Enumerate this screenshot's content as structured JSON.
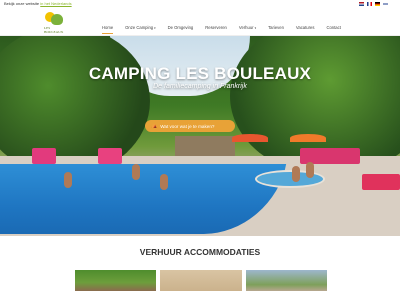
{
  "topbar": {
    "view_text": "Bekijk onze website",
    "view_link": "in het Nederlands"
  },
  "languages": [
    {
      "icon": "nl-flag-icon",
      "color": "#ae1c28"
    },
    {
      "icon": "fr-flag-icon",
      "color": "#1f3d8c"
    },
    {
      "icon": "de-flag-icon",
      "color": "#f5c400"
    },
    {
      "icon": "en-flag-icon",
      "color": "#1f3d8c"
    }
  ],
  "logo": {
    "line1": "LES",
    "line2": "BOULEAUX"
  },
  "nav": {
    "items": [
      {
        "label": "Home",
        "active": true
      },
      {
        "label": "Onze Camping",
        "caret": "▾"
      },
      {
        "label": "De Omgeving"
      },
      {
        "label": "Reserveren"
      },
      {
        "label": "Verhuur",
        "caret": "▾"
      },
      {
        "label": "Tarieven"
      },
      {
        "label": "Vacatures"
      },
      {
        "label": "Contact"
      }
    ]
  },
  "hero": {
    "title": "CAMPING LES BOULEAUX",
    "subtitle": "De familiecamping in Frankrijk",
    "cta_label": "Wat voor wat je te maken?"
  },
  "section": {
    "title": "VERHUUR ACCOMMODATIES"
  },
  "colors": {
    "accent": "#e8a237",
    "brand_green": "#7bb13a"
  }
}
